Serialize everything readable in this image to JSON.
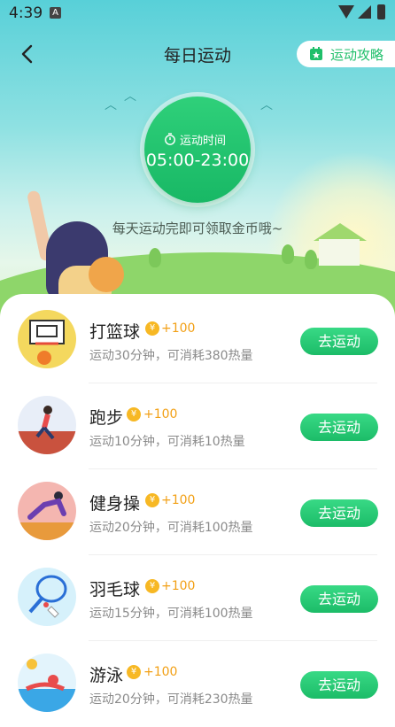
{
  "status_bar": {
    "time": "4:39",
    "notification_icon": "A"
  },
  "nav": {
    "title": "每日运动",
    "guide_label": "运动攻略"
  },
  "hero": {
    "time_label": "运动时间",
    "time_range": "05:00-23:00",
    "hint": "每天运动完即可领取金币哦~"
  },
  "activities": [
    {
      "name": "打篮球",
      "coin": "¥",
      "reward": "+100",
      "desc": "运动30分钟，可消耗380热量",
      "button": "去运动",
      "icon": "basketball-icon"
    },
    {
      "name": "跑步",
      "coin": "¥",
      "reward": "+100",
      "desc": "运动10分钟，可消耗10热量",
      "button": "去运动",
      "icon": "running-icon"
    },
    {
      "name": "健身操",
      "coin": "¥",
      "reward": "+100",
      "desc": "运动20分钟，可消耗100热量",
      "button": "去运动",
      "icon": "fitness-icon"
    },
    {
      "name": "羽毛球",
      "coin": "¥",
      "reward": "+100",
      "desc": "运动15分钟，可消耗100热量",
      "button": "去运动",
      "icon": "badminton-icon"
    },
    {
      "name": "游泳",
      "coin": "¥",
      "reward": "+100",
      "desc": "运动20分钟，可消耗230热量",
      "button": "去运动",
      "icon": "swimming-icon"
    }
  ],
  "colors": {
    "accent": "#1fbf6a",
    "coin": "#f7b824",
    "reward": "#f2a016"
  }
}
